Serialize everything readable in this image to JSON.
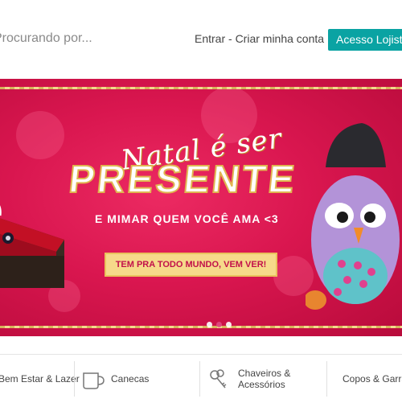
{
  "header": {
    "search_placeholder": "Procurando por...",
    "login_text": "Entrar - Criar minha conta",
    "lojista_button": "Acesso Lojista",
    "accent_color": "#0aa3a3"
  },
  "banner": {
    "headline_script": "Natal é ser",
    "headline_big": "PRESENTE",
    "subline": "E MIMAR QUEM VOCÊ AMA <3",
    "cta": "TEM PRA TODO MUNDO, VEM VER!",
    "background_color": "#d9164f",
    "slides": 3,
    "active_slide": 2
  },
  "categories": [
    {
      "label": "Bem Estar & Lazer",
      "icon": "leisure-icon"
    },
    {
      "label": "Canecas",
      "icon": "mug-icon"
    },
    {
      "label": "Chaveiros & Acessórios",
      "icon": "keys-icon"
    },
    {
      "label": "Copos & Garrafas",
      "icon": "cup-icon"
    }
  ]
}
